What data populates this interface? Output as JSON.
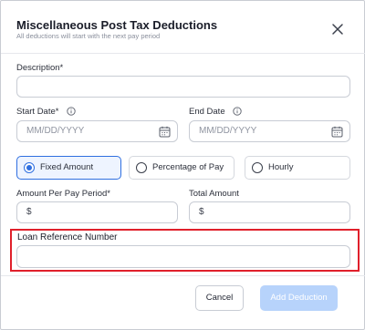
{
  "modal": {
    "title": "Miscellaneous Post Tax Deductions",
    "subtitle": "All deductions will start with the next pay period"
  },
  "form": {
    "description_label": "Description*",
    "description_value": "",
    "start_date_label": "Start Date*",
    "start_date_placeholder": "MM/DD/YYYY",
    "end_date_label": "End Date",
    "end_date_placeholder": "MM/DD/YYYY",
    "amount_types": [
      {
        "label": "Fixed Amount",
        "selected": true
      },
      {
        "label": "Percentage of Pay",
        "selected": false
      },
      {
        "label": "Hourly",
        "selected": false
      }
    ],
    "amount_per_period_label": "Amount Per Pay Period*",
    "amount_per_period_prefix": "$",
    "total_amount_label": "Total Amount",
    "total_amount_prefix": "$",
    "loan_reference_label": "Loan Reference Number",
    "loan_reference_value": ""
  },
  "footer": {
    "cancel_label": "Cancel",
    "add_label": "Add Deduction"
  },
  "colors": {
    "accent": "#2f6fe0",
    "highlight": "#e0202b",
    "primary_disabled": "#b7d3fb"
  },
  "icons": [
    "close-icon",
    "info-icon",
    "calendar-icon"
  ]
}
